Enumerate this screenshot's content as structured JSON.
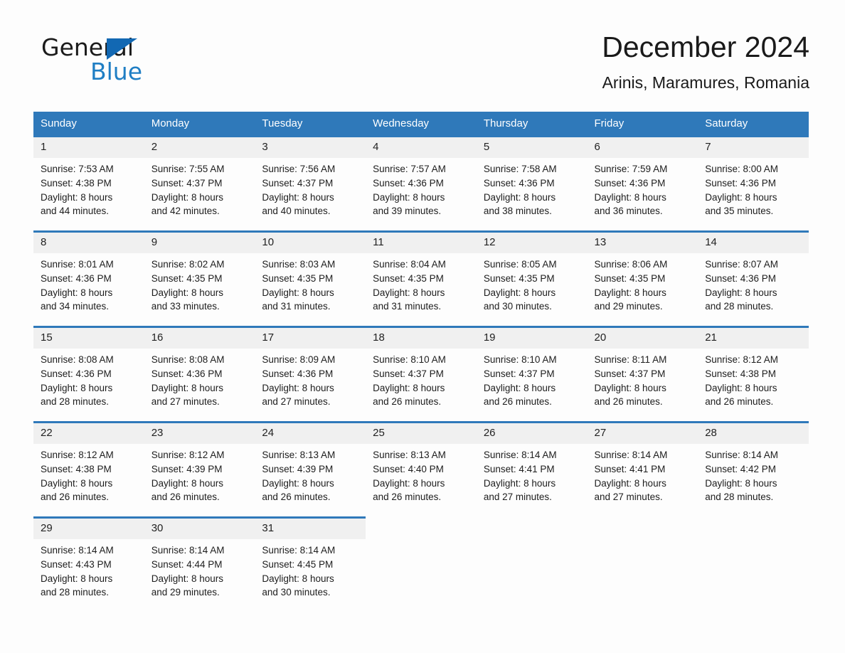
{
  "brand": {
    "word_one": "General",
    "word_two": "Blue",
    "triangle_icon": "triangle-logo-icon",
    "accent_color": "#1f7ec4"
  },
  "header": {
    "month_title": "December 2024",
    "location": "Arinis, Maramures, Romania"
  },
  "calendar": {
    "header_bg": "#2f79ba",
    "daynum_bg": "#f0f0f0",
    "weekdays": [
      "Sunday",
      "Monday",
      "Tuesday",
      "Wednesday",
      "Thursday",
      "Friday",
      "Saturday"
    ],
    "weeks": [
      [
        {
          "day": "1",
          "sunrise": "Sunrise: 7:53 AM",
          "sunset": "Sunset: 4:38 PM",
          "daylight_line1": "Daylight: 8 hours",
          "daylight_line2": "and 44 minutes."
        },
        {
          "day": "2",
          "sunrise": "Sunrise: 7:55 AM",
          "sunset": "Sunset: 4:37 PM",
          "daylight_line1": "Daylight: 8 hours",
          "daylight_line2": "and 42 minutes."
        },
        {
          "day": "3",
          "sunrise": "Sunrise: 7:56 AM",
          "sunset": "Sunset: 4:37 PM",
          "daylight_line1": "Daylight: 8 hours",
          "daylight_line2": "and 40 minutes."
        },
        {
          "day": "4",
          "sunrise": "Sunrise: 7:57 AM",
          "sunset": "Sunset: 4:36 PM",
          "daylight_line1": "Daylight: 8 hours",
          "daylight_line2": "and 39 minutes."
        },
        {
          "day": "5",
          "sunrise": "Sunrise: 7:58 AM",
          "sunset": "Sunset: 4:36 PM",
          "daylight_line1": "Daylight: 8 hours",
          "daylight_line2": "and 38 minutes."
        },
        {
          "day": "6",
          "sunrise": "Sunrise: 7:59 AM",
          "sunset": "Sunset: 4:36 PM",
          "daylight_line1": "Daylight: 8 hours",
          "daylight_line2": "and 36 minutes."
        },
        {
          "day": "7",
          "sunrise": "Sunrise: 8:00 AM",
          "sunset": "Sunset: 4:36 PM",
          "daylight_line1": "Daylight: 8 hours",
          "daylight_line2": "and 35 minutes."
        }
      ],
      [
        {
          "day": "8",
          "sunrise": "Sunrise: 8:01 AM",
          "sunset": "Sunset: 4:36 PM",
          "daylight_line1": "Daylight: 8 hours",
          "daylight_line2": "and 34 minutes."
        },
        {
          "day": "9",
          "sunrise": "Sunrise: 8:02 AM",
          "sunset": "Sunset: 4:35 PM",
          "daylight_line1": "Daylight: 8 hours",
          "daylight_line2": "and 33 minutes."
        },
        {
          "day": "10",
          "sunrise": "Sunrise: 8:03 AM",
          "sunset": "Sunset: 4:35 PM",
          "daylight_line1": "Daylight: 8 hours",
          "daylight_line2": "and 31 minutes."
        },
        {
          "day": "11",
          "sunrise": "Sunrise: 8:04 AM",
          "sunset": "Sunset: 4:35 PM",
          "daylight_line1": "Daylight: 8 hours",
          "daylight_line2": "and 31 minutes."
        },
        {
          "day": "12",
          "sunrise": "Sunrise: 8:05 AM",
          "sunset": "Sunset: 4:35 PM",
          "daylight_line1": "Daylight: 8 hours",
          "daylight_line2": "and 30 minutes."
        },
        {
          "day": "13",
          "sunrise": "Sunrise: 8:06 AM",
          "sunset": "Sunset: 4:35 PM",
          "daylight_line1": "Daylight: 8 hours",
          "daylight_line2": "and 29 minutes."
        },
        {
          "day": "14",
          "sunrise": "Sunrise: 8:07 AM",
          "sunset": "Sunset: 4:36 PM",
          "daylight_line1": "Daylight: 8 hours",
          "daylight_line2": "and 28 minutes."
        }
      ],
      [
        {
          "day": "15",
          "sunrise": "Sunrise: 8:08 AM",
          "sunset": "Sunset: 4:36 PM",
          "daylight_line1": "Daylight: 8 hours",
          "daylight_line2": "and 28 minutes."
        },
        {
          "day": "16",
          "sunrise": "Sunrise: 8:08 AM",
          "sunset": "Sunset: 4:36 PM",
          "daylight_line1": "Daylight: 8 hours",
          "daylight_line2": "and 27 minutes."
        },
        {
          "day": "17",
          "sunrise": "Sunrise: 8:09 AM",
          "sunset": "Sunset: 4:36 PM",
          "daylight_line1": "Daylight: 8 hours",
          "daylight_line2": "and 27 minutes."
        },
        {
          "day": "18",
          "sunrise": "Sunrise: 8:10 AM",
          "sunset": "Sunset: 4:37 PM",
          "daylight_line1": "Daylight: 8 hours",
          "daylight_line2": "and 26 minutes."
        },
        {
          "day": "19",
          "sunrise": "Sunrise: 8:10 AM",
          "sunset": "Sunset: 4:37 PM",
          "daylight_line1": "Daylight: 8 hours",
          "daylight_line2": "and 26 minutes."
        },
        {
          "day": "20",
          "sunrise": "Sunrise: 8:11 AM",
          "sunset": "Sunset: 4:37 PM",
          "daylight_line1": "Daylight: 8 hours",
          "daylight_line2": "and 26 minutes."
        },
        {
          "day": "21",
          "sunrise": "Sunrise: 8:12 AM",
          "sunset": "Sunset: 4:38 PM",
          "daylight_line1": "Daylight: 8 hours",
          "daylight_line2": "and 26 minutes."
        }
      ],
      [
        {
          "day": "22",
          "sunrise": "Sunrise: 8:12 AM",
          "sunset": "Sunset: 4:38 PM",
          "daylight_line1": "Daylight: 8 hours",
          "daylight_line2": "and 26 minutes."
        },
        {
          "day": "23",
          "sunrise": "Sunrise: 8:12 AM",
          "sunset": "Sunset: 4:39 PM",
          "daylight_line1": "Daylight: 8 hours",
          "daylight_line2": "and 26 minutes."
        },
        {
          "day": "24",
          "sunrise": "Sunrise: 8:13 AM",
          "sunset": "Sunset: 4:39 PM",
          "daylight_line1": "Daylight: 8 hours",
          "daylight_line2": "and 26 minutes."
        },
        {
          "day": "25",
          "sunrise": "Sunrise: 8:13 AM",
          "sunset": "Sunset: 4:40 PM",
          "daylight_line1": "Daylight: 8 hours",
          "daylight_line2": "and 26 minutes."
        },
        {
          "day": "26",
          "sunrise": "Sunrise: 8:14 AM",
          "sunset": "Sunset: 4:41 PM",
          "daylight_line1": "Daylight: 8 hours",
          "daylight_line2": "and 27 minutes."
        },
        {
          "day": "27",
          "sunrise": "Sunrise: 8:14 AM",
          "sunset": "Sunset: 4:41 PM",
          "daylight_line1": "Daylight: 8 hours",
          "daylight_line2": "and 27 minutes."
        },
        {
          "day": "28",
          "sunrise": "Sunrise: 8:14 AM",
          "sunset": "Sunset: 4:42 PM",
          "daylight_line1": "Daylight: 8 hours",
          "daylight_line2": "and 28 minutes."
        }
      ],
      [
        {
          "day": "29",
          "sunrise": "Sunrise: 8:14 AM",
          "sunset": "Sunset: 4:43 PM",
          "daylight_line1": "Daylight: 8 hours",
          "daylight_line2": "and 28 minutes."
        },
        {
          "day": "30",
          "sunrise": "Sunrise: 8:14 AM",
          "sunset": "Sunset: 4:44 PM",
          "daylight_line1": "Daylight: 8 hours",
          "daylight_line2": "and 29 minutes."
        },
        {
          "day": "31",
          "sunrise": "Sunrise: 8:14 AM",
          "sunset": "Sunset: 4:45 PM",
          "daylight_line1": "Daylight: 8 hours",
          "daylight_line2": "and 30 minutes."
        },
        {
          "day": "",
          "sunrise": "",
          "sunset": "",
          "daylight_line1": "",
          "daylight_line2": ""
        },
        {
          "day": "",
          "sunrise": "",
          "sunset": "",
          "daylight_line1": "",
          "daylight_line2": ""
        },
        {
          "day": "",
          "sunrise": "",
          "sunset": "",
          "daylight_line1": "",
          "daylight_line2": ""
        },
        {
          "day": "",
          "sunrise": "",
          "sunset": "",
          "daylight_line1": "",
          "daylight_line2": ""
        }
      ]
    ]
  }
}
